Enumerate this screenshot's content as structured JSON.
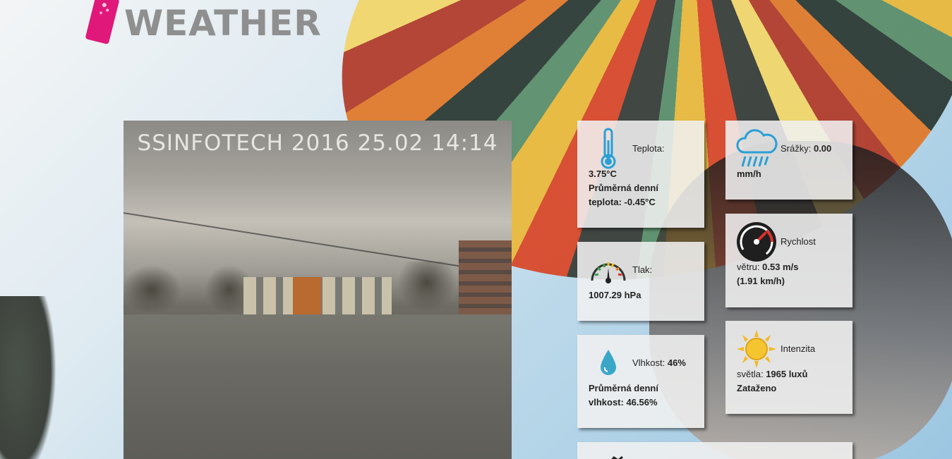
{
  "logo": {
    "text": "WEATHER"
  },
  "webcam": {
    "stamp": "SSINFOTECH 2016 25.02 14:14"
  },
  "cards": {
    "teplota": {
      "label": "Teplota:",
      "value": "3.75°C",
      "avg_line1": "Průměrná denní",
      "avg_line2": "teplota: -0.45°C"
    },
    "tlak": {
      "label": "Tlak:",
      "value": "1007.29 hPa"
    },
    "vlhkost": {
      "label": "Vlhkost:",
      "value": "46%",
      "avg_line1": "Průměrná denní",
      "avg_line2": "vlhkost: 46.56%"
    },
    "srazky": {
      "label": "Srážky:",
      "value": "0.00",
      "unit": "mm/h"
    },
    "vitr": {
      "label": "Rychlost",
      "line2_prefix": "větru:",
      "value_ms": "0.53 m/s",
      "value_kmh": "(1.91 km/h)"
    },
    "svetlo": {
      "label": "Intenzita",
      "line2_prefix": "světla:",
      "value": "1965 luxů",
      "condition": "Zataženo"
    }
  },
  "icons": {
    "teplota": "thermometer-icon",
    "tlak": "gauge-icon",
    "vlhkost": "water-drop-icon",
    "srazky": "rain-cloud-icon",
    "vitr": "speedometer-icon",
    "svetlo": "sun-icon"
  },
  "colors": {
    "brand_pink": "#e0187a",
    "logo_gray": "#8f8f8f",
    "icon_blue": "#2a9fd6"
  }
}
